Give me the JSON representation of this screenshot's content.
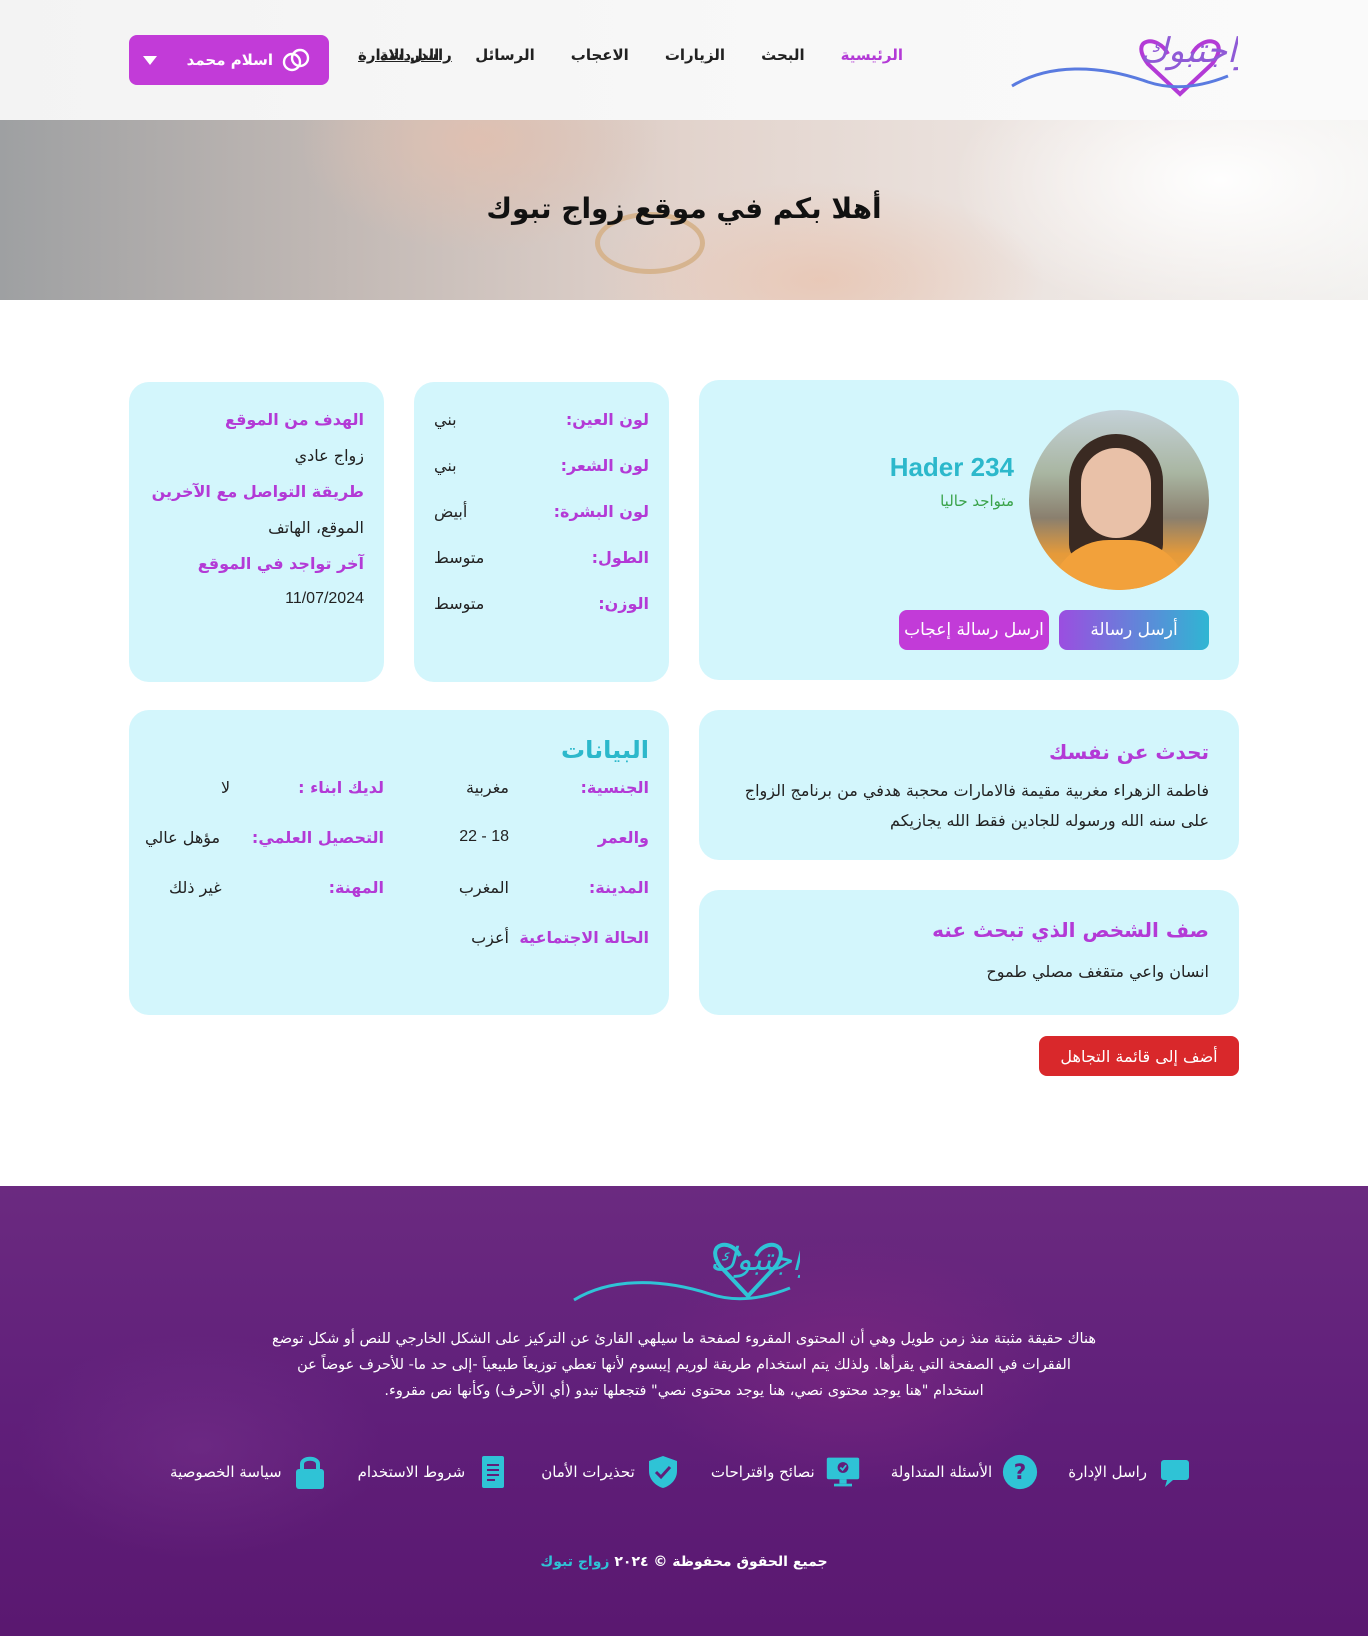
{
  "header": {
    "nav": [
      {
        "label": "الرئيسية",
        "active": true
      },
      {
        "label": "البحث"
      },
      {
        "label": "الزيارات"
      },
      {
        "label": "الاعجاب"
      },
      {
        "label": "الرسائل"
      },
      {
        "label": "الدردشة"
      }
    ],
    "contact_admin": "راسل الادارة",
    "user_name": "اسلام محمد"
  },
  "hero": {
    "title": "أهلا بكم في موقع زواج تبوك"
  },
  "profile": {
    "name": "Hader 234",
    "status": "متواجد حاليا",
    "send_message": "أرسل رسالة",
    "send_like": "ارسل رسالة  إعجاب"
  },
  "attributes": [
    {
      "key": "لون العين:",
      "value": "بني"
    },
    {
      "key": "لون الشعر:",
      "value": "بني"
    },
    {
      "key": "لون البشرة:",
      "value": "أبيض"
    },
    {
      "key": "الطول:",
      "value": "متوسط"
    },
    {
      "key": "الوزن:",
      "value": "متوسط"
    }
  ],
  "goal": {
    "goal_label": "الهدف من الموقع",
    "goal_value": "زواج عادي",
    "contact_label": "طريقة التواصل مع الآخرين",
    "contact_value": "الموقع، الهاتف",
    "last_seen_label": "آخر تواجد في الموقع",
    "last_seen_value": "11/07/2024"
  },
  "about": {
    "title": "تحدث عن نفسك",
    "text": "فاطمة الزهراء مغربية مقيمة فالامارات محجبة هدفي من برنامج الزواج على سنه الله ورسوله للجادين فقط الله يجازيكم"
  },
  "seek": {
    "title": "صف الشخص الذي تبحث عنه",
    "text": "انسان واعي متقغف مصلي طموح"
  },
  "data": {
    "title": "البيانات",
    "right_col": [
      {
        "key": "الجنسية:",
        "value": "مغربية"
      },
      {
        "key": "والعمر",
        "value": "18 - 22"
      },
      {
        "key": "المدينة:",
        "value": "المغرب"
      },
      {
        "key": "الحالة الاجتماعية",
        "value": "أعزب"
      }
    ],
    "left_col": [
      {
        "key": "لديك ابناء :",
        "value": "لا"
      },
      {
        "key": "التحصيل العلمي:",
        "value": "مؤهل عالي"
      },
      {
        "key": "المهنة:",
        "value": "غير ذلك"
      }
    ]
  },
  "ignore_button": "أضف إلى قائمة التجاهل",
  "footer": {
    "text": "هناك حقيقة مثبتة منذ زمن طويل وهي أن المحتوى المقروء لصفحة ما سيلهي القارئ عن التركيز على الشكل الخارجي للنص أو شكل توضع الفقرات في الصفحة التي يقرأها. ولذلك يتم استخدام طريقة لوريم إيبسوم لأنها تعطي توزيعاَ طبيعياَ -إلى حد ما- للأحرف عوضاً عن استخدام \"هنا يوجد محتوى نصي، هنا يوجد محتوى نصي\" فتجعلها تبدو (أي الأحرف) وكأنها نص مقروء.",
    "links": [
      {
        "label": "راسل الإدارة",
        "icon": "chat-icon"
      },
      {
        "label": "الأسئلة المتداولة",
        "icon": "question-icon"
      },
      {
        "label": "نصائح واقتراحات",
        "icon": "monitor-icon"
      },
      {
        "label": "تحذيرات الأمان",
        "icon": "shield-icon"
      },
      {
        "label": "شروط الاستخدام",
        "icon": "document-icon"
      },
      {
        "label": "سياسة الخصوصية",
        "icon": "lock-icon"
      }
    ],
    "copyright_prefix": "جميع الحقوق محفوظة © ٢٠٢٤",
    "copyright_brand": "زواج تبوك"
  },
  "colors": {
    "accent_purple": "#c23bd8",
    "accent_cyan": "#2cb8cb",
    "card_bg": "#d3f6fc",
    "danger": "#d9282b",
    "footer_bg": "#601f7a"
  }
}
